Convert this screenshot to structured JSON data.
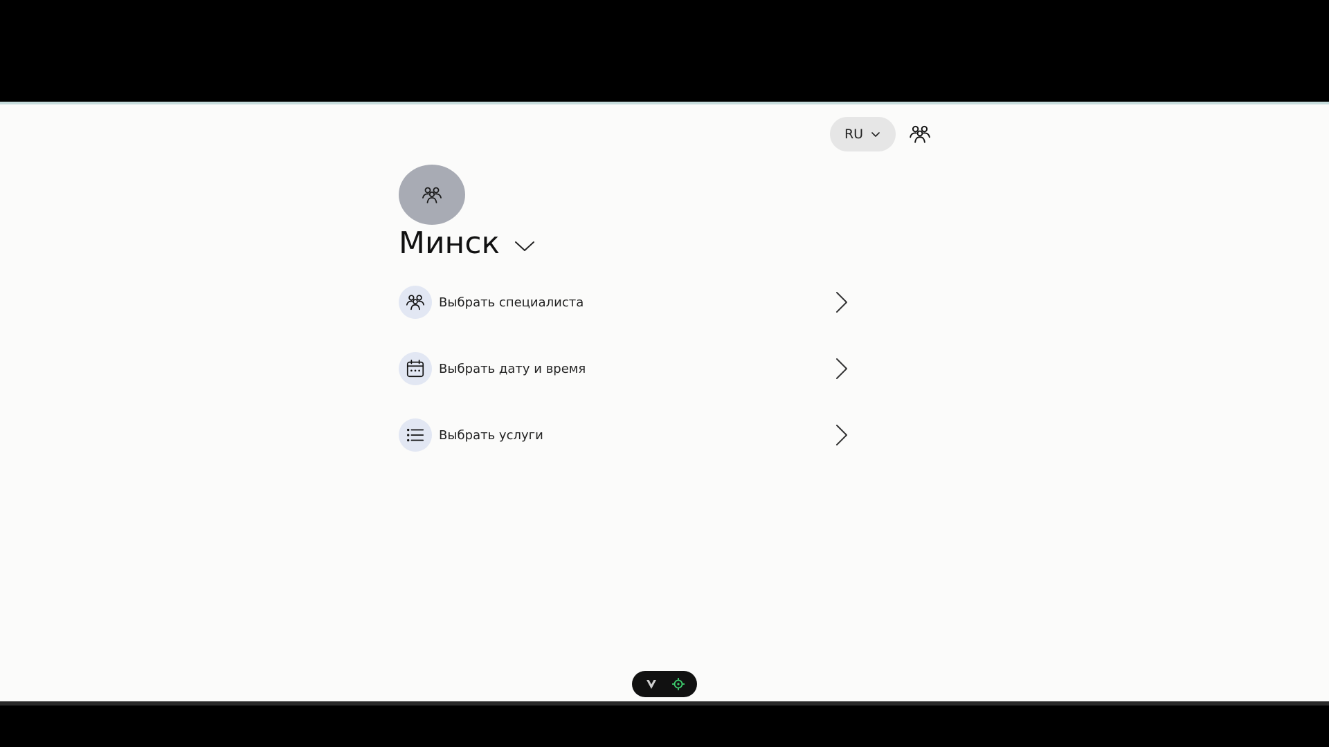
{
  "header": {
    "language": "RU",
    "language_icon": "chevron-down-icon",
    "team_icon": "people-icon"
  },
  "location": {
    "avatar_icon": "people-icon",
    "city": "Минск",
    "city_icon": "chevron-down-icon"
  },
  "menu": {
    "items": [
      {
        "label": "Выбрать специалиста",
        "icon": "people-icon"
      },
      {
        "label": "Выбрать дату и время",
        "icon": "calendar-icon"
      },
      {
        "label": "Выбрать услуги",
        "icon": "list-icon"
      }
    ]
  },
  "devbar": {
    "left_icon": "v-logo-icon",
    "right_icon": "target-icon",
    "accent_color": "#3ecf6e"
  },
  "colors": {
    "background": "#fbfbfa",
    "avatar_bg": "#a8abb4",
    "icon_bg": "#e2e7f3",
    "lang_bg": "#e6e6e6"
  }
}
